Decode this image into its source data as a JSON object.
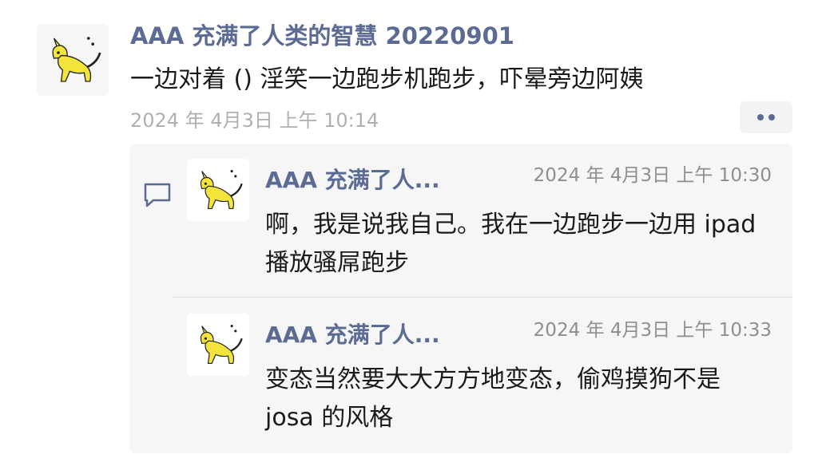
{
  "post": {
    "author": "AAA 充满了人类的智慧 20220901",
    "text": "一边对着 () 淫笑一边跑步机跑步，吓晕旁边阿姨",
    "time": "2024 年 4月3日 上午 10:14",
    "avatar_icon": "cat-icon",
    "more_icon": "more-dots-icon"
  },
  "comments": {
    "icon": "comment-bubble-icon",
    "items": [
      {
        "author": "AAA 充满了人...",
        "time": "2024 年 4月3日 上午 10:30",
        "text": "啊，我是说我自己。我在一边跑步一边用 ipad 播放骚屌跑步",
        "avatar_icon": "cat-icon"
      },
      {
        "author": "AAA 充满了人...",
        "time": "2024 年 4月3日 上午 10:33",
        "text": "变态当然要大大方方地变态，偷鸡摸狗不是 josa 的风格",
        "avatar_icon": "cat-icon"
      }
    ]
  },
  "colors": {
    "name": "#5b6b93",
    "text": "#1a1a1a",
    "time": "#b0b0b0",
    "cat_yellow": "#f2e43a",
    "comments_bg": "#f6f6f7"
  }
}
